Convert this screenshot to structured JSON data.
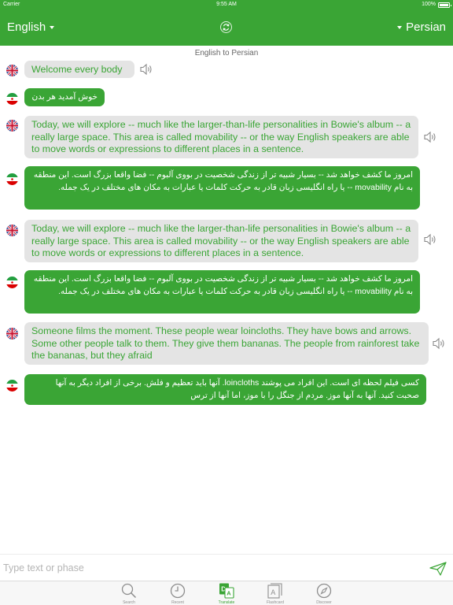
{
  "status_bar": {
    "carrier": "Carrier",
    "time": "9:55 AM",
    "battery": "100%"
  },
  "header": {
    "source_language": "English",
    "target_language": "Persian"
  },
  "direction_caption": "English to Persian",
  "messages": [
    {
      "lang": "en",
      "text": "Welcome every body"
    },
    {
      "lang": "fa",
      "text": "خوش آمدید هر بدن"
    },
    {
      "lang": "en",
      "text": "Today, we will explore -- much like the larger-than-life personalities in Bowie's album -- a really large space. This area is called movability -- or the way English speakers are able to move words or expressions to different places in a sentence."
    },
    {
      "lang": "fa",
      "text": "امروز ما کشف خواهد شد -- بسیار شبیه تر از زندگی شخصیت در بووی آلبوم -- فضا واقعا بزرگ است. این منطقه به نام movability -- یا راه انگلیسی زبان قادر به حرکت کلمات یا عبارات به مکان های مختلف در یک جمله."
    },
    {
      "lang": "en",
      "text": "Today, we will explore -- much like the larger-than-life personalities in Bowie's album -- a really large space. This area is called movability -- or the way English speakers are able to move words or expressions to different places in a sentence."
    },
    {
      "lang": "fa",
      "text": "امروز ما کشف خواهد شد -- بسیار شبیه تر از زندگی شخصیت در بووی آلبوم -- فضا واقعا بزرگ است. این منطقه به نام movability -- یا راه انگلیسی زبان قادر به حرکت کلمات یا عبارات به مکان های مختلف در یک جمله."
    },
    {
      "lang": "en",
      "text": "Someone films the moment. These people wear loincloths. They have bows and arrows. Some other people talk to them. They give them bananas. The people from rainforest  take the bananas, but they afraid"
    },
    {
      "lang": "fa",
      "text": "کسی فیلم لحظه ای است. این افراد می پوشند loincloths. آنها باید تعظیم و فلش. برخی از افراد دیگر به آنها صحبت کنید. آنها به آنها موز. مردم از جنگل را با موز، اما آنها از ترس"
    }
  ],
  "input": {
    "placeholder": "Type text or phase",
    "value": ""
  },
  "tabs": [
    {
      "label": "Search",
      "icon": "magnifier-icon",
      "active": false
    },
    {
      "label": "Recent",
      "icon": "clock-icon",
      "active": false
    },
    {
      "label": "Translate",
      "icon": "translate-icon",
      "active": true
    },
    {
      "label": "Flashcard",
      "icon": "flashcard-icon",
      "active": false
    },
    {
      "label": "Discover",
      "icon": "compass-icon",
      "active": false
    }
  ],
  "colors": {
    "accent": "#3aa535",
    "bubble_gray": "#e4e4e4",
    "tab_inactive": "#8e8e8e"
  }
}
